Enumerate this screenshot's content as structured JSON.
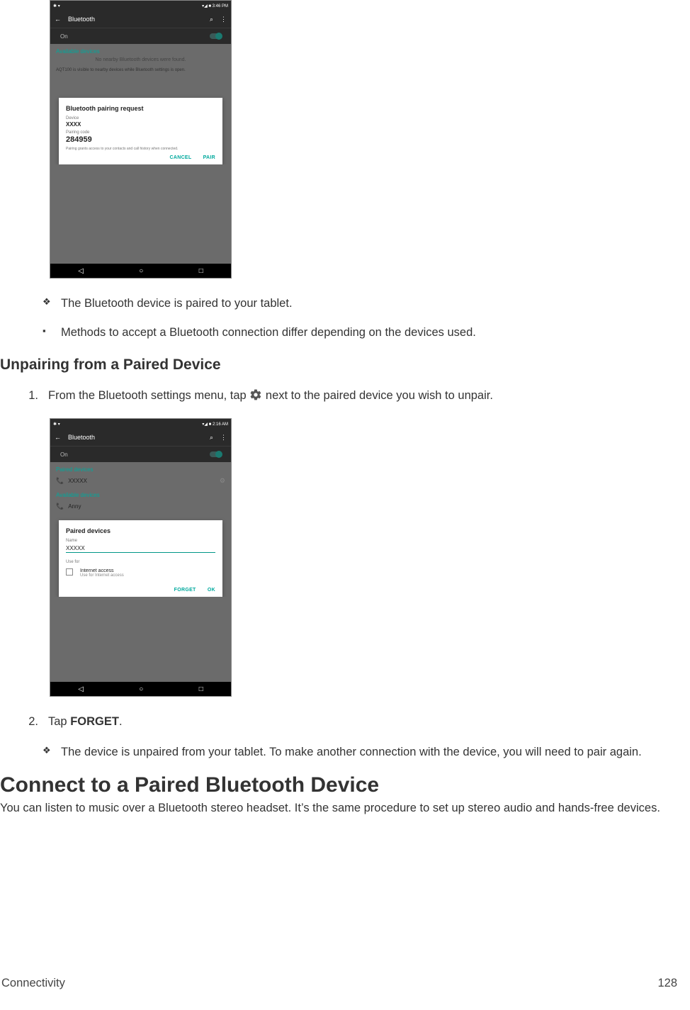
{
  "screenshot1": {
    "status": {
      "left_icons": "✱ ▾",
      "right": "▾◢ ■ 3:46 PM"
    },
    "appbar": {
      "back": "←",
      "title": "Bluetooth",
      "search": "⌕",
      "menu": "⋮"
    },
    "toggle": {
      "label": "On"
    },
    "section": "Available devices",
    "scan_msg": "No nearby Bluetooth devices were found.",
    "visible_note": "AQT100 is visible to nearby devices while Bluetooth settings is open.",
    "dialog": {
      "title": "Bluetooth pairing request",
      "device_lbl": "Device",
      "device_val": "XXXX",
      "code_lbl": "Pairing code",
      "code_val": "284959",
      "note": "Pairing grants access to your contacts and call history when connected.",
      "cancel": "CANCEL",
      "pair": "PAIR"
    },
    "nav": {
      "back": "◁",
      "home": "○",
      "recent": "□"
    }
  },
  "text": {
    "paired_result": "The Bluetooth device is paired to your tablet.",
    "methods_note": "Methods to accept a Bluetooth connection differ depending on the devices used.",
    "unpair_heading": "Unpairing from a Paired Device",
    "step1_pre": "From the Bluetooth settings menu, tap ",
    "step1_post": " next to the paired device you wish to unpair.",
    "step2_pre": "Tap ",
    "step2_bold": "FORGET",
    "step2_post": ".",
    "unpaired_result": "The device is unpaired from your tablet. To make another connection with the device, you will need to pair again.",
    "h2": "Connect to a Paired Bluetooth Device",
    "h2_para": "You can listen to music over a Bluetooth stereo headset. It’s the same procedure to set up stereo audio and hands-free devices."
  },
  "screenshot2": {
    "status": {
      "left_icons": "✱ ▾",
      "right": "▾◢ ■ 2:16 AM"
    },
    "appbar": {
      "back": "←",
      "title": "Bluetooth",
      "search": "⌕",
      "menu": "⋮"
    },
    "toggle": {
      "label": "On"
    },
    "paired_section": "Paired devices",
    "paired_device": "XXXXX",
    "available_section": "Available devices",
    "available_device": "Anny",
    "dialog": {
      "title": "Paired devices",
      "name_lbl": "Name",
      "name_val": "XXXXX",
      "use_for": "Use for",
      "opt_title": "Internet access",
      "opt_sub": "Use for Internet access",
      "forget": "FORGET",
      "ok": "OK"
    },
    "nav": {
      "back": "◁",
      "home": "○",
      "recent": "□"
    }
  },
  "footer": {
    "section": "Connectivity",
    "page": "128"
  },
  "bullets": {
    "diamond": "❖",
    "square": "▪"
  },
  "ol": {
    "n1": "1.",
    "n2": "2."
  }
}
